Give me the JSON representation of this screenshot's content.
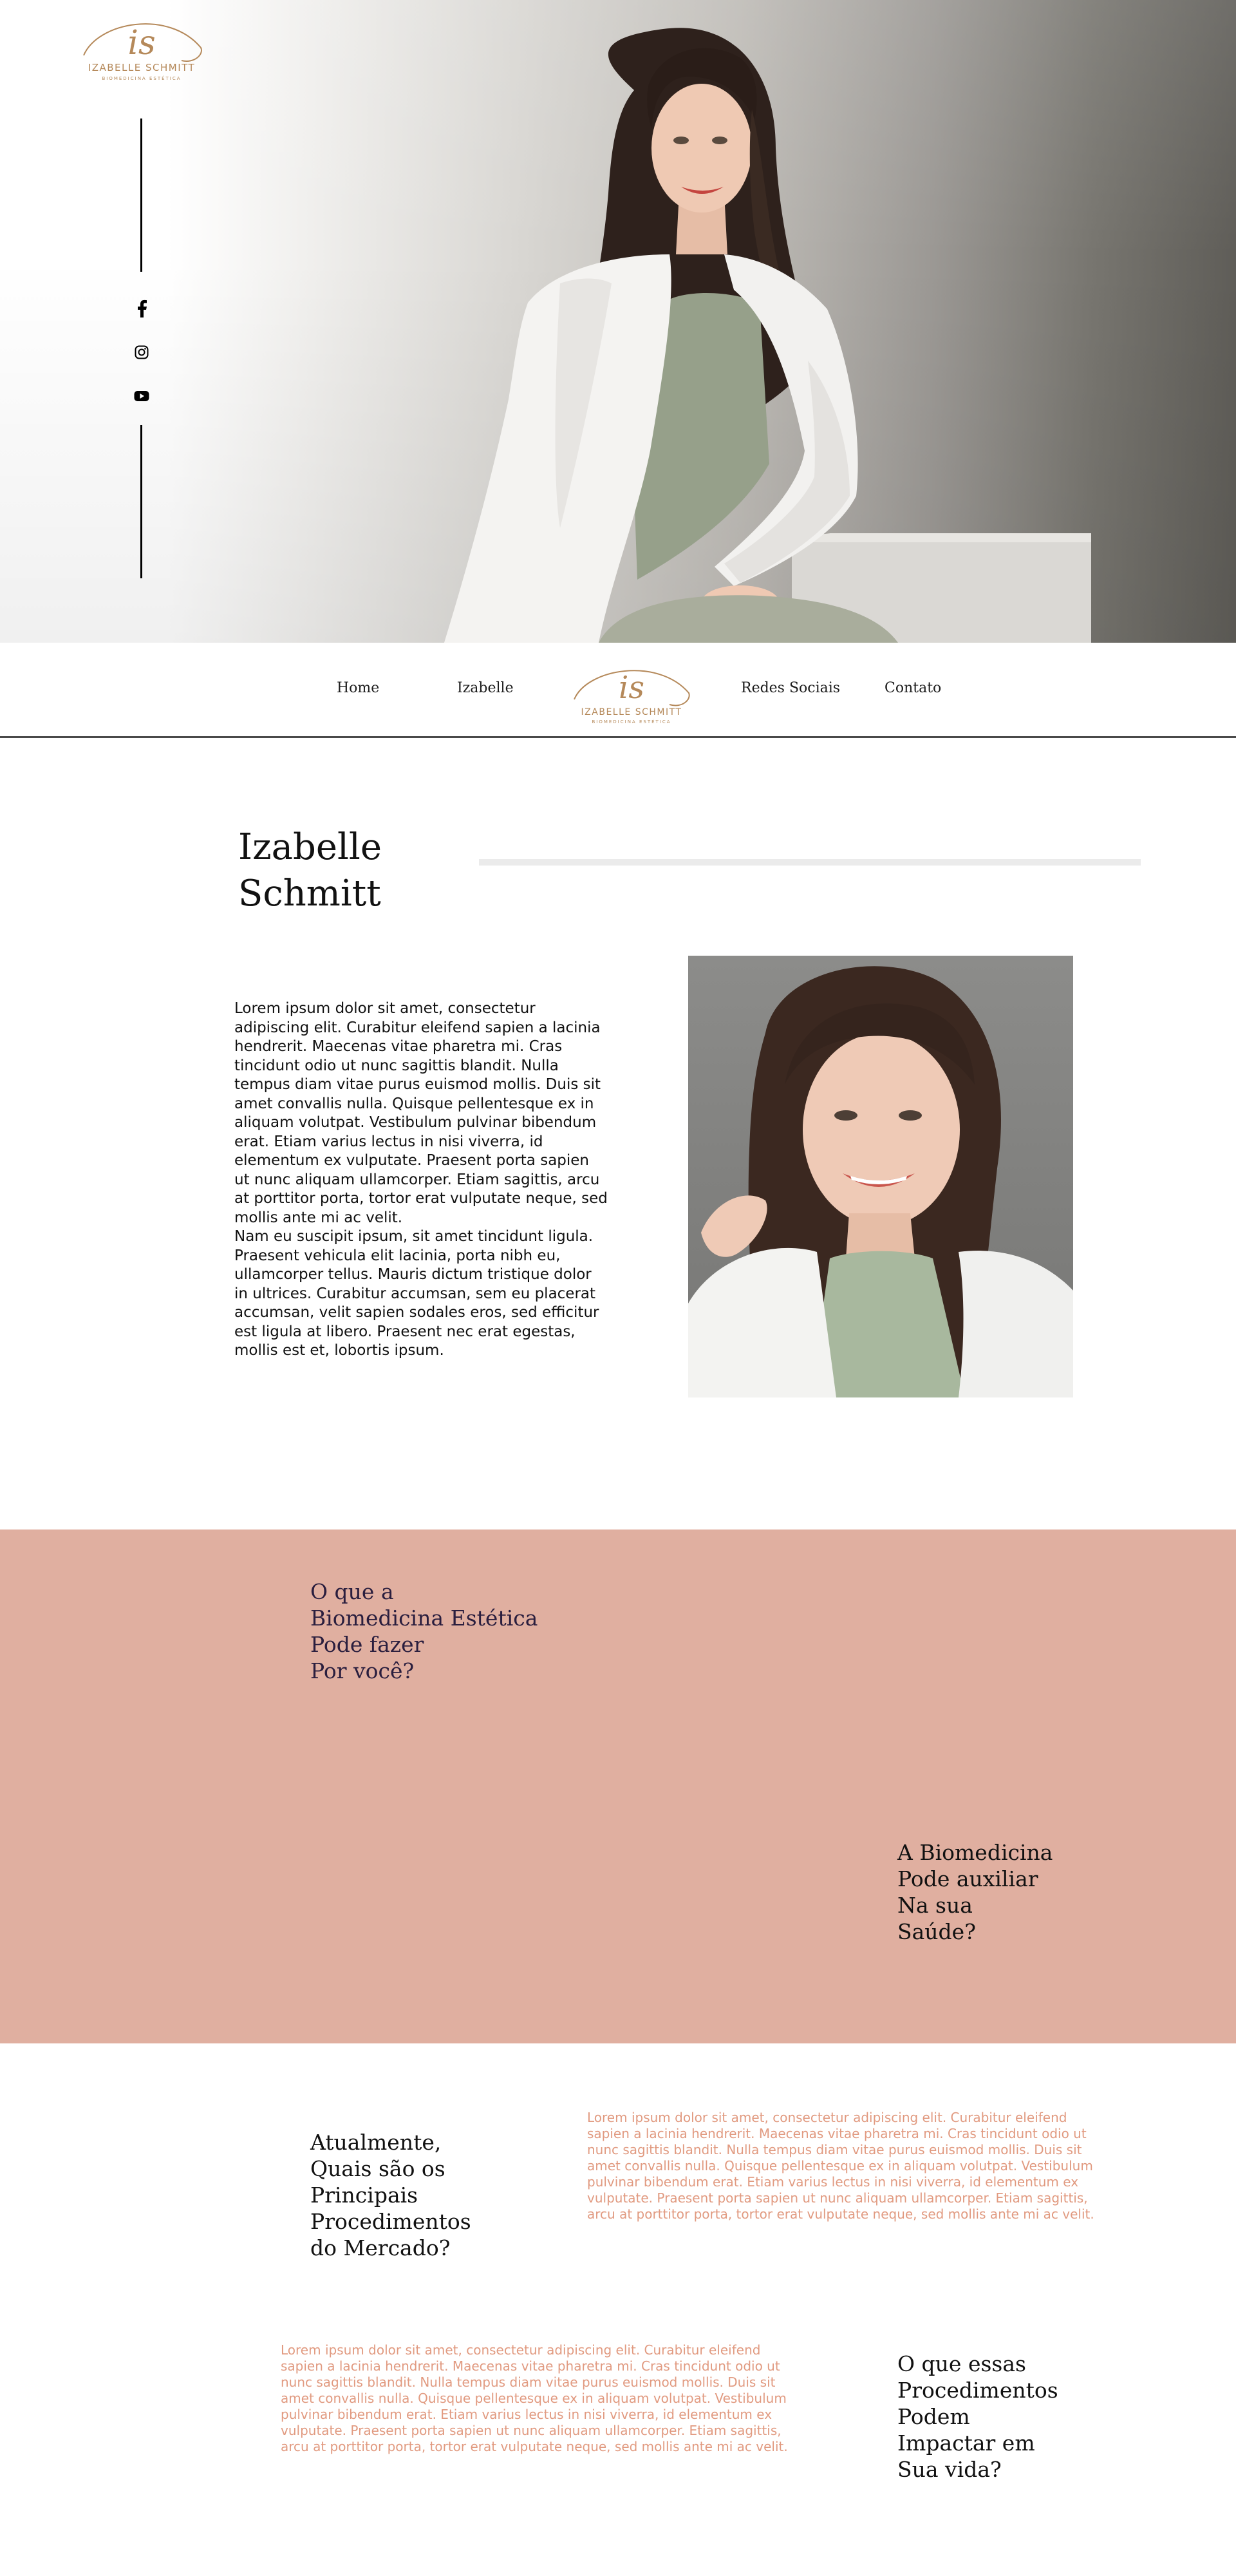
{
  "brand": {
    "monogram": "is",
    "name": "IZABELLE SCHMITT",
    "tagline": "BIOMEDICINA ESTÉTICA",
    "gold": "#b5895a"
  },
  "social": [
    {
      "icon": "facebook-icon",
      "label": "Facebook"
    },
    {
      "icon": "instagram-icon",
      "label": "Instagram"
    },
    {
      "icon": "youtube-icon",
      "label": "YouTube"
    }
  ],
  "nav": {
    "home": "Home",
    "izabelle": "Izabelle",
    "redes": "Redes Sociais",
    "contato": "Contato"
  },
  "about": {
    "title_line1": "Izabelle",
    "title_line2": "Schmitt",
    "text": "Lorem ipsum dolor sit amet, consectetur adipiscing elit. Curabitur eleifend sapien a lacinia hendrerit. Maecenas vitae pharetra mi. Cras tincidunt odio ut nunc sagittis blandit. Nulla tempus diam vitae purus euismod mollis. Duis sit amet convallis nulla. Quisque pellentesque ex in aliquam volutpat. Vestibulum pulvinar bibendum erat. Etiam varius lectus in nisi viverra, id elementum ex vulputate. Praesent porta sapien ut nunc aliquam ullamcorper. Etiam sagittis, arcu at porttitor porta, tortor erat vulputate neque, sed mollis ante mi ac velit.\nNam eu suscipit ipsum, sit amet tincidunt ligula. Praesent vehicula elit lacinia, porta nibh eu, ullamcorper tellus. Mauris dictum tristique dolor in ultrices. Curabitur accumsan, sem eu placerat accumsan, velit sapien sodales eros, sed efficitur est ligula at libero. Praesent nec erat egestas, mollis est et, lobortis ipsum."
  },
  "pink_section": {
    "color": "#e0afa0",
    "question": "O que a\nBiomedicina Estética\nPode fazer\nPor você?",
    "answer_title": "A Biomedicina\nPode auxiliar\nNa sua\nSaúde?"
  },
  "procedures": {
    "title": "Atualmente,\nQuais são os\nPrincipais\nProcedimentos\ndo Mercado?",
    "text": "Lorem ipsum dolor sit amet, consectetur adipiscing elit. Curabitur eleifend sapien a lacinia hendrerit. Maecenas vitae pharetra mi. Cras tincidunt odio ut nunc sagittis blandit. Nulla tempus diam vitae purus euismod mollis. Duis sit amet convallis nulla. Quisque pellentesque ex in aliquam volutpat. Vestibulum pulvinar bibendum erat. Etiam varius lectus in nisi viverra, id elementum ex vulputate. Praesent porta sapien ut nunc aliquam ullamcorper. Etiam sagittis, arcu at porttitor porta, tortor erat vulputate neque, sed mollis ante mi ac velit."
  },
  "impact": {
    "title": "O que essas\nProcedimentos\nPodem\nImpactar em\nSua vida?",
    "text": "Lorem ipsum dolor sit amet, consectetur adipiscing elit. Curabitur eleifend sapien a lacinia hendrerit. Maecenas vitae pharetra mi. Cras tincidunt odio ut nunc sagittis blandit. Nulla tempus diam vitae purus euismod mollis. Duis sit amet convallis nulla. Quisque pellentesque ex in aliquam volutpat. Vestibulum pulvinar bibendum erat. Etiam varius lectus in nisi viverra, id elementum ex vulputate. Praesent porta sapien ut nunc aliquam ullamcorper. Etiam sagittis, arcu at porttitor porta, tortor erat vulputate neque, sed mollis ante mi ac velit."
  }
}
